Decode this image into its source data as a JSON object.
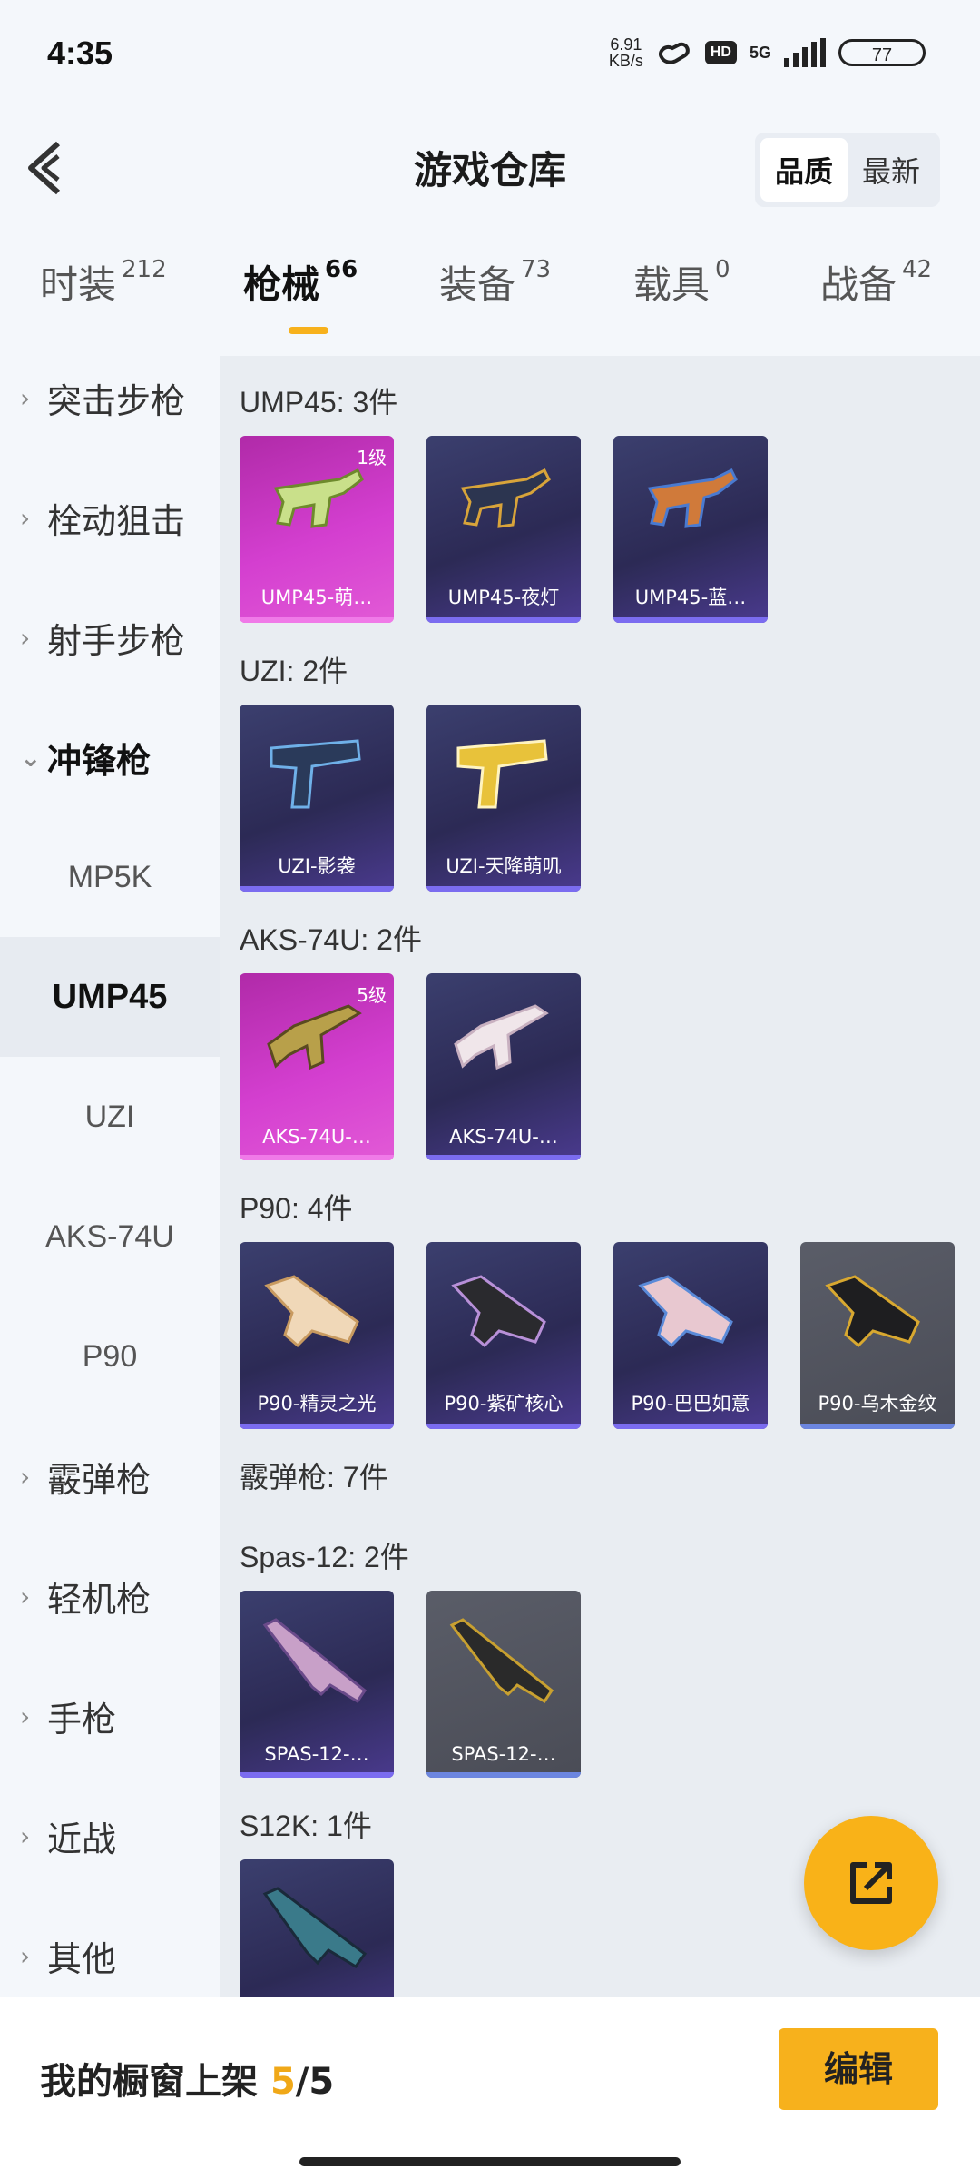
{
  "status": {
    "time": "4:35",
    "speed_value": "6.91",
    "speed_unit": "KB/s",
    "hd": "HD",
    "network": "5G",
    "battery": "77"
  },
  "header": {
    "title": "游戏仓库",
    "sort_quality": "品质",
    "sort_latest": "最新"
  },
  "tabs": [
    {
      "label": "时装",
      "count": "212"
    },
    {
      "label": "枪械",
      "count": "66"
    },
    {
      "label": "装备",
      "count": "73"
    },
    {
      "label": "载具",
      "count": "0"
    },
    {
      "label": "战备",
      "count": "42"
    }
  ],
  "sidebar": {
    "assault_rifle": "突击步枪",
    "bolt_sniper": "栓动狙击",
    "marksman_rifle": "射手步枪",
    "smg": "冲锋枪",
    "mp5k": "MP5K",
    "ump45": "UMP45",
    "uzi": "UZI",
    "aks74u": "AKS-74U",
    "p90": "P90",
    "shotgun": "霰弹枪",
    "lmg": "轻机枪",
    "pistol": "手枪",
    "melee": "近战",
    "other": "其他"
  },
  "groups": {
    "ump45": {
      "title": "UMP45: 3件",
      "items": [
        "UMP45-萌…",
        "UMP45-夜灯",
        "UMP45-蓝…"
      ],
      "level": "1级"
    },
    "uzi": {
      "title": "UZI: 2件",
      "items": [
        "UZI-影袭",
        "UZI-天降萌叽"
      ]
    },
    "aks74u": {
      "title": "AKS-74U: 2件",
      "items": [
        "AKS-74U-…",
        "AKS-74U-…"
      ],
      "level": "5级"
    },
    "p90": {
      "title": "P90: 4件",
      "items": [
        "P90-精灵之光",
        "P90-紫矿核心",
        "P90-巴巴如意",
        "P90-乌木金纹"
      ]
    },
    "shotgun": {
      "title": "霰弹枪: 7件"
    },
    "spas12": {
      "title": "Spas-12: 2件",
      "items": [
        "SPAS-12-…",
        "SPAS-12-…"
      ]
    },
    "s12k": {
      "title": "S12K: 1件"
    }
  },
  "bottom": {
    "shelf_label": "我的橱窗上架",
    "shelf_current": "5",
    "shelf_total": "/5",
    "edit": "编辑"
  },
  "colors": {
    "accent": "#f7b11c",
    "rare_purple": "#7b6cf0",
    "legendary_pink": "#d43fd0"
  },
  "icons": [
    "back-arrow-icon",
    "chevron-right-icon",
    "chevron-down-icon",
    "share-icon",
    "wifi-icon",
    "signal-icon",
    "battery-icon"
  ]
}
